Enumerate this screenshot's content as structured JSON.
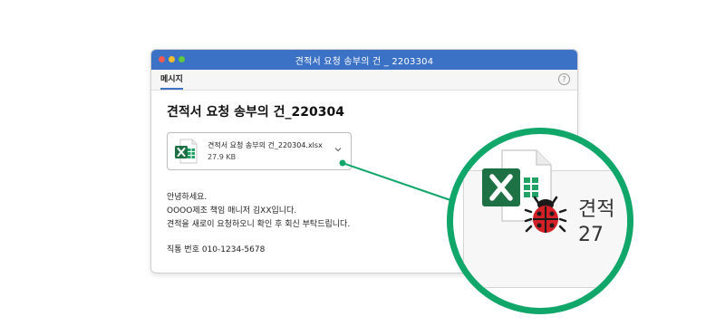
{
  "window": {
    "title": "견적서 요청 송부의 건 _ 2203304",
    "tab_label": "메시지",
    "help_symbol": "?"
  },
  "email": {
    "subject": "견적서 요청 송부의 건_220304",
    "attachment": {
      "file_name": "견적서 요청 송부의 건_220304.xlsx",
      "file_size": "27.9 KB",
      "file_icon": "excel-icon",
      "expand_icon": "chevron-down-icon"
    },
    "body_lines": [
      "안녕하세요.",
      "OOOO제조 책임 매니저 김XX입니다.",
      "견적을 새로이 요청하오니 확인 후 회신 부탁드립니다."
    ],
    "contact": "직통 번호 010-1234-5678"
  },
  "zoom": {
    "name_fragment": "견적",
    "size_fragment": "27",
    "file_icon": "excel-icon",
    "threat_icon": "bug-icon",
    "accent_color": "#11a66a"
  },
  "colors": {
    "titlebar": "#3c72c6",
    "excel_green": "#1e7145",
    "bug_red": "#d32027"
  }
}
